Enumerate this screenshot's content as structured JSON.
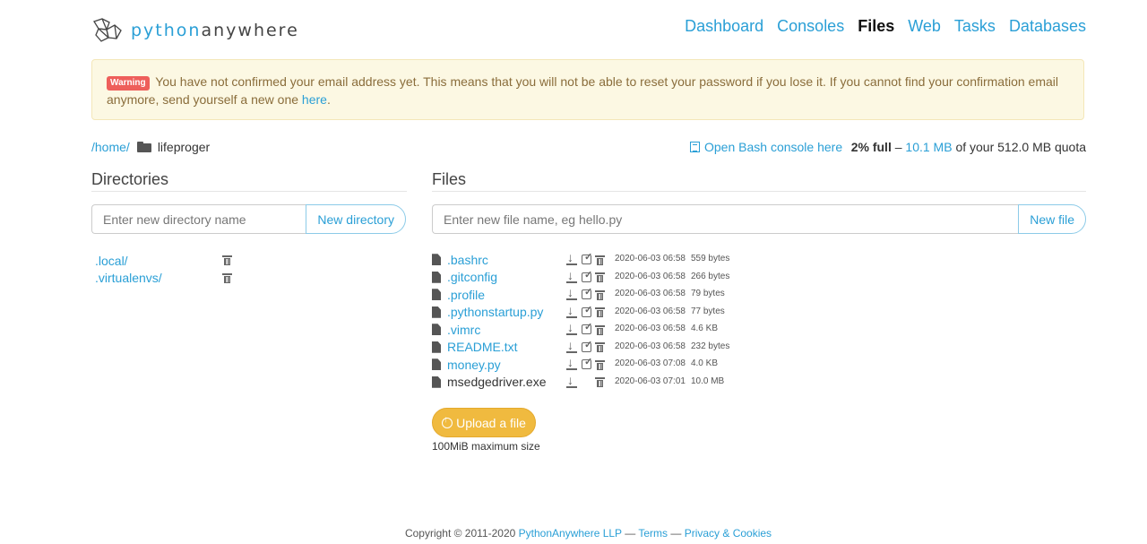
{
  "brand": {
    "name_part1": "python",
    "name_part2": "anywhere"
  },
  "nav": [
    {
      "label": "Dashboard",
      "active": false
    },
    {
      "label": "Consoles",
      "active": false
    },
    {
      "label": "Files",
      "active": true
    },
    {
      "label": "Web",
      "active": false
    },
    {
      "label": "Tasks",
      "active": false
    },
    {
      "label": "Databases",
      "active": false
    }
  ],
  "warning": {
    "badge": "Warning",
    "text": "You have not confirmed your email address yet. This means that you will not be able to reset your password if you lose it. If you cannot find your confirmation email anymore, send yourself a new one",
    "link": "here",
    "suffix": "."
  },
  "breadcrumb": {
    "home": "/home/",
    "current": "lifeproger"
  },
  "bash_link": "Open Bash console here",
  "quota": {
    "percent": "2% full",
    "sep": " – ",
    "used": "10.1 MB",
    "rest": " of your 512.0 MB quota"
  },
  "directories": {
    "title": "Directories",
    "placeholder": "Enter new directory name",
    "button": "New directory",
    "items": [
      ".local/",
      ".virtualenvs/"
    ]
  },
  "files": {
    "title": "Files",
    "placeholder": "Enter new file name, eg hello.py",
    "button": "New file",
    "items": [
      {
        "name": ".bashrc",
        "date": "2020-06-03 06:58",
        "size": "559 bytes",
        "editable": true
      },
      {
        "name": ".gitconfig",
        "date": "2020-06-03 06:58",
        "size": "266 bytes",
        "editable": true
      },
      {
        "name": ".profile",
        "date": "2020-06-03 06:58",
        "size": "79 bytes",
        "editable": true
      },
      {
        "name": ".pythonstartup.py",
        "date": "2020-06-03 06:58",
        "size": "77 bytes",
        "editable": true
      },
      {
        "name": ".vimrc",
        "date": "2020-06-03 06:58",
        "size": "4.6 KB",
        "editable": true
      },
      {
        "name": "README.txt",
        "date": "2020-06-03 06:58",
        "size": "232 bytes",
        "editable": true
      },
      {
        "name": "money.py",
        "date": "2020-06-03 07:08",
        "size": "4.0 KB",
        "editable": true
      },
      {
        "name": "msedgedriver.exe",
        "date": "2020-06-03 07:01",
        "size": "10.0 MB",
        "editable": false
      }
    ]
  },
  "upload": {
    "button": "Upload a file",
    "note": "100MiB maximum size"
  },
  "footer": {
    "copyright": "Copyright © 2011-2020",
    "company": "PythonAnywhere LLP",
    "sep": "—",
    "terms": "Terms",
    "privacy": "Privacy & Cookies"
  },
  "colors": {
    "link": "#2a9fd6",
    "warning_bg": "#fcf8e3",
    "upload": "#f0ba3f",
    "badge": "#ee5f5b"
  }
}
